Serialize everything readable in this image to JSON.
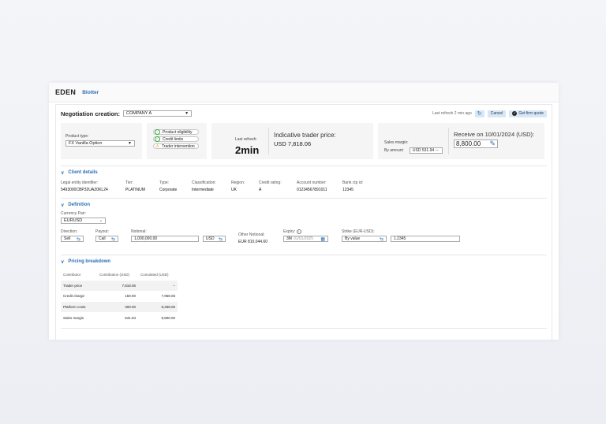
{
  "app": {
    "name": "EDEN",
    "link": "Blotter"
  },
  "header": {
    "title": "Negotiation creation:",
    "company": "COMPANY A",
    "last_refresh": "Last refresh 2 min ago",
    "cancel_label": "Cancel",
    "quote_label": "Get firm quote"
  },
  "product": {
    "label": "Product type:",
    "value": "FX Vanilla Option"
  },
  "checks": {
    "eligibility": "Product eligibility",
    "credit": "Credit limits",
    "trader": "Trader intervention"
  },
  "indicative": {
    "refresh_label": "Last refresh:",
    "refresh_value": "2min",
    "title": "Indicative trader price:",
    "value": "USD 7,818.06"
  },
  "sales": {
    "label": "Sales margin:",
    "mode": "By amount",
    "amount": "USD 531.94",
    "receive_label": "Receive on 10/01/2024 (USD):",
    "receive_value": "8,800.00"
  },
  "client": {
    "title": "Client details",
    "fields": [
      {
        "label": "Legal entity identifier:",
        "value": "5493000CBP32UAZ0KL24"
      },
      {
        "label": "Tier:",
        "value": "PLATINUM"
      },
      {
        "label": "Type:",
        "value": "Corporate"
      },
      {
        "label": "Classification:",
        "value": "Intermediate"
      },
      {
        "label": "Region:",
        "value": "UK"
      },
      {
        "label": "Credit rating:",
        "value": "A"
      },
      {
        "label": "Account number:",
        "value": "01234567891011"
      },
      {
        "label": "Bank ctp id:",
        "value": "12345"
      }
    ]
  },
  "definition": {
    "title": "Definition",
    "pair_label": "Currency Pair:",
    "pair_value": "EURUSD",
    "direction_label": "Direction:",
    "direction_value": "Sell",
    "payout_label": "Payout:",
    "payout_value": "Call",
    "notional_label": "Notional:",
    "notional_value": "1,000,000.00",
    "notional_ccy": "USD",
    "other_label": "Other Notional:",
    "other_value": "EUR 810,044.60",
    "expiry_label": "Expiry:",
    "expiry_tenor": "3M",
    "expiry_date": "01/01/2025",
    "strike_label": "Strike (EUR-USD):",
    "strike_mode": "By value",
    "strike_value": "1.2345"
  },
  "pricing": {
    "title": "Pricing breakdown",
    "headers": [
      "Contributor",
      "Contribution (USD)",
      "Cumulated (USD)"
    ],
    "rows": [
      [
        "Trader price",
        "7,818.06",
        "–"
      ],
      [
        "Credit charge",
        "150.00",
        "7,968.06"
      ],
      [
        "Platform costs",
        "300.00",
        "8,268.06"
      ],
      [
        "Sales margin",
        "531.94",
        "8,800.00"
      ]
    ]
  }
}
